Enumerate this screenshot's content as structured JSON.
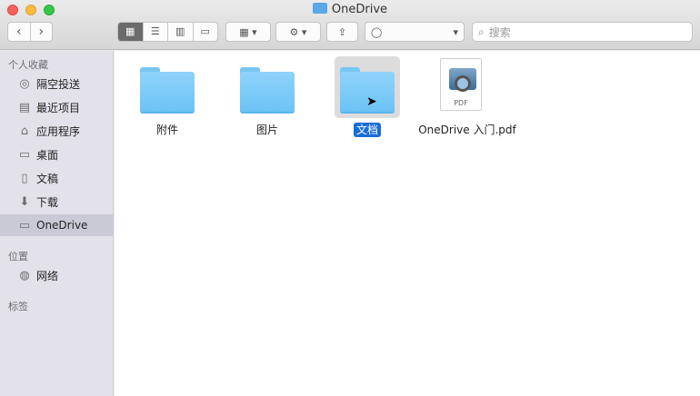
{
  "window": {
    "title": "OneDrive"
  },
  "toolbar": {
    "back": "‹",
    "forward": "›",
    "view_icons": [
      "▦",
      "☰",
      "▥",
      "▭"
    ],
    "arrange_icon": "▦ ▾",
    "action_icon": "⚙ ▾",
    "share_icon": "⇪",
    "tags_icon": "◯",
    "tags_chevron": "▾",
    "search_placeholder": "搜索"
  },
  "sidebar": {
    "favorites_title": "个人收藏",
    "favorites": [
      {
        "label": "隔空投送",
        "icon": "airdrop-icon",
        "glyph": "◎"
      },
      {
        "label": "最近项目",
        "icon": "recents-icon",
        "glyph": "▤"
      },
      {
        "label": "应用程序",
        "icon": "applications-icon",
        "glyph": "⌂"
      },
      {
        "label": "桌面",
        "icon": "desktop-icon",
        "glyph": "▭"
      },
      {
        "label": "文稿",
        "icon": "documents-icon",
        "glyph": "▯"
      },
      {
        "label": "下载",
        "icon": "downloads-icon",
        "glyph": "⬇"
      },
      {
        "label": "OneDrive",
        "icon": "folder-icon",
        "glyph": "▭",
        "active": true
      }
    ],
    "locations_title": "位置",
    "locations": [
      {
        "label": "网络",
        "icon": "network-icon",
        "glyph": "◍"
      }
    ],
    "tags_title": "标签"
  },
  "files": [
    {
      "name": "附件",
      "type": "folder"
    },
    {
      "name": "图片",
      "type": "folder"
    },
    {
      "name": "文档",
      "type": "folder",
      "selected": true
    },
    {
      "name": "OneDrive 入门.pdf",
      "type": "pdf",
      "icon_text": "PDF"
    }
  ],
  "colors": {
    "selection": "#1a6cd9",
    "folder": "#6cc3f5",
    "sidebar_active": "#cac9d6"
  }
}
